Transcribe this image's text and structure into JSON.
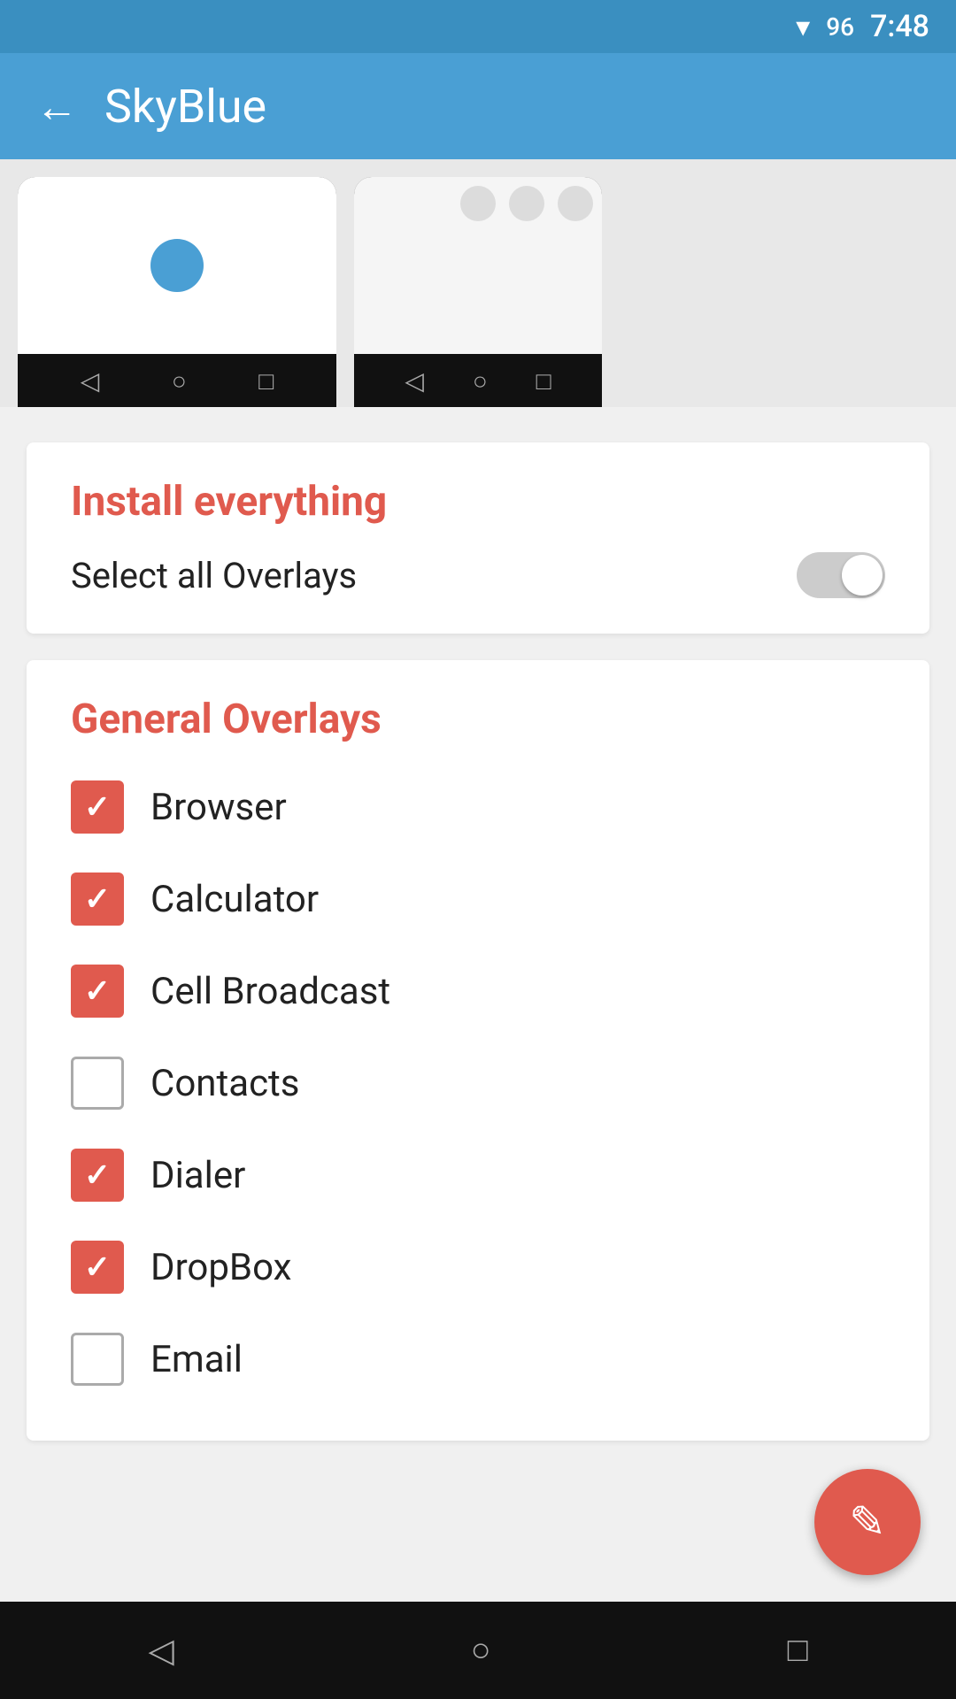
{
  "statusBar": {
    "time": "7:48",
    "battery": "96",
    "wifiIcon": "▼"
  },
  "appBar": {
    "title": "SkyBlue",
    "backLabel": "←"
  },
  "installCard": {
    "title": "Install everything",
    "toggleLabel": "Select all Overlays",
    "toggleState": false
  },
  "overlaysCard": {
    "title": "General Overlays",
    "items": [
      {
        "label": "Browser",
        "checked": true
      },
      {
        "label": "Calculator",
        "checked": true
      },
      {
        "label": "Cell Broadcast",
        "checked": true
      },
      {
        "label": "Contacts",
        "checked": false
      },
      {
        "label": "Dialer",
        "checked": true
      },
      {
        "label": "DropBox",
        "checked": true
      },
      {
        "label": "Email",
        "checked": false
      }
    ]
  },
  "bottomNav": {
    "back": "◁",
    "home": "○",
    "recents": "□"
  },
  "fab": {
    "icon": "✎"
  }
}
